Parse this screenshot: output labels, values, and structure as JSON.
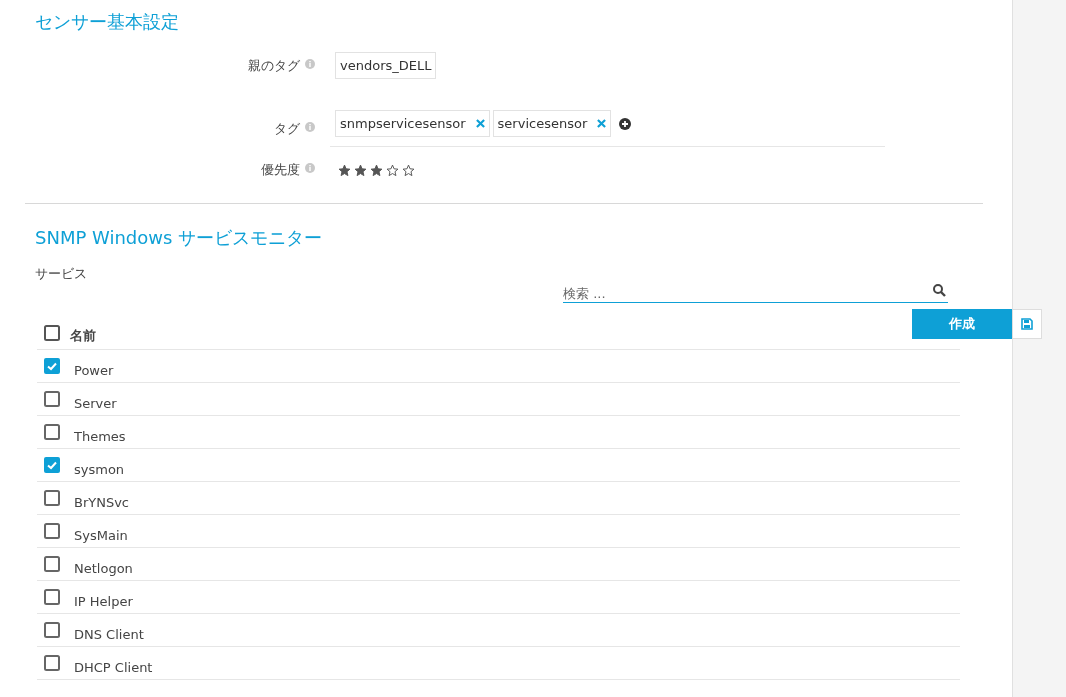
{
  "basic_settings": {
    "title": "センサー基本設定",
    "parent_tag": {
      "label": "親のタグ",
      "value": "vendors_DELL"
    },
    "tags": {
      "label": "タグ",
      "items": [
        "snmpservicesensor",
        "servicesensor"
      ]
    },
    "priority": {
      "label": "優先度",
      "stars": 3
    }
  },
  "service_monitor": {
    "title": "SNMP Windows サービスモニター",
    "services_label": "サービス",
    "search": {
      "placeholder": "検索 ..."
    },
    "header": {
      "label": "名前",
      "checked": false
    },
    "rows": [
      {
        "name": "Power",
        "checked": true
      },
      {
        "name": "Server",
        "checked": false
      },
      {
        "name": "Themes",
        "checked": false
      },
      {
        "name": "sysmon",
        "checked": true
      },
      {
        "name": "BrYNSvc",
        "checked": false
      },
      {
        "name": "SysMain",
        "checked": false
      },
      {
        "name": "Netlogon",
        "checked": false
      },
      {
        "name": "IP Helper",
        "checked": false
      },
      {
        "name": "DNS Client",
        "checked": false
      },
      {
        "name": "DHCP Client",
        "checked": false
      }
    ]
  },
  "actions": {
    "create": "作成"
  }
}
